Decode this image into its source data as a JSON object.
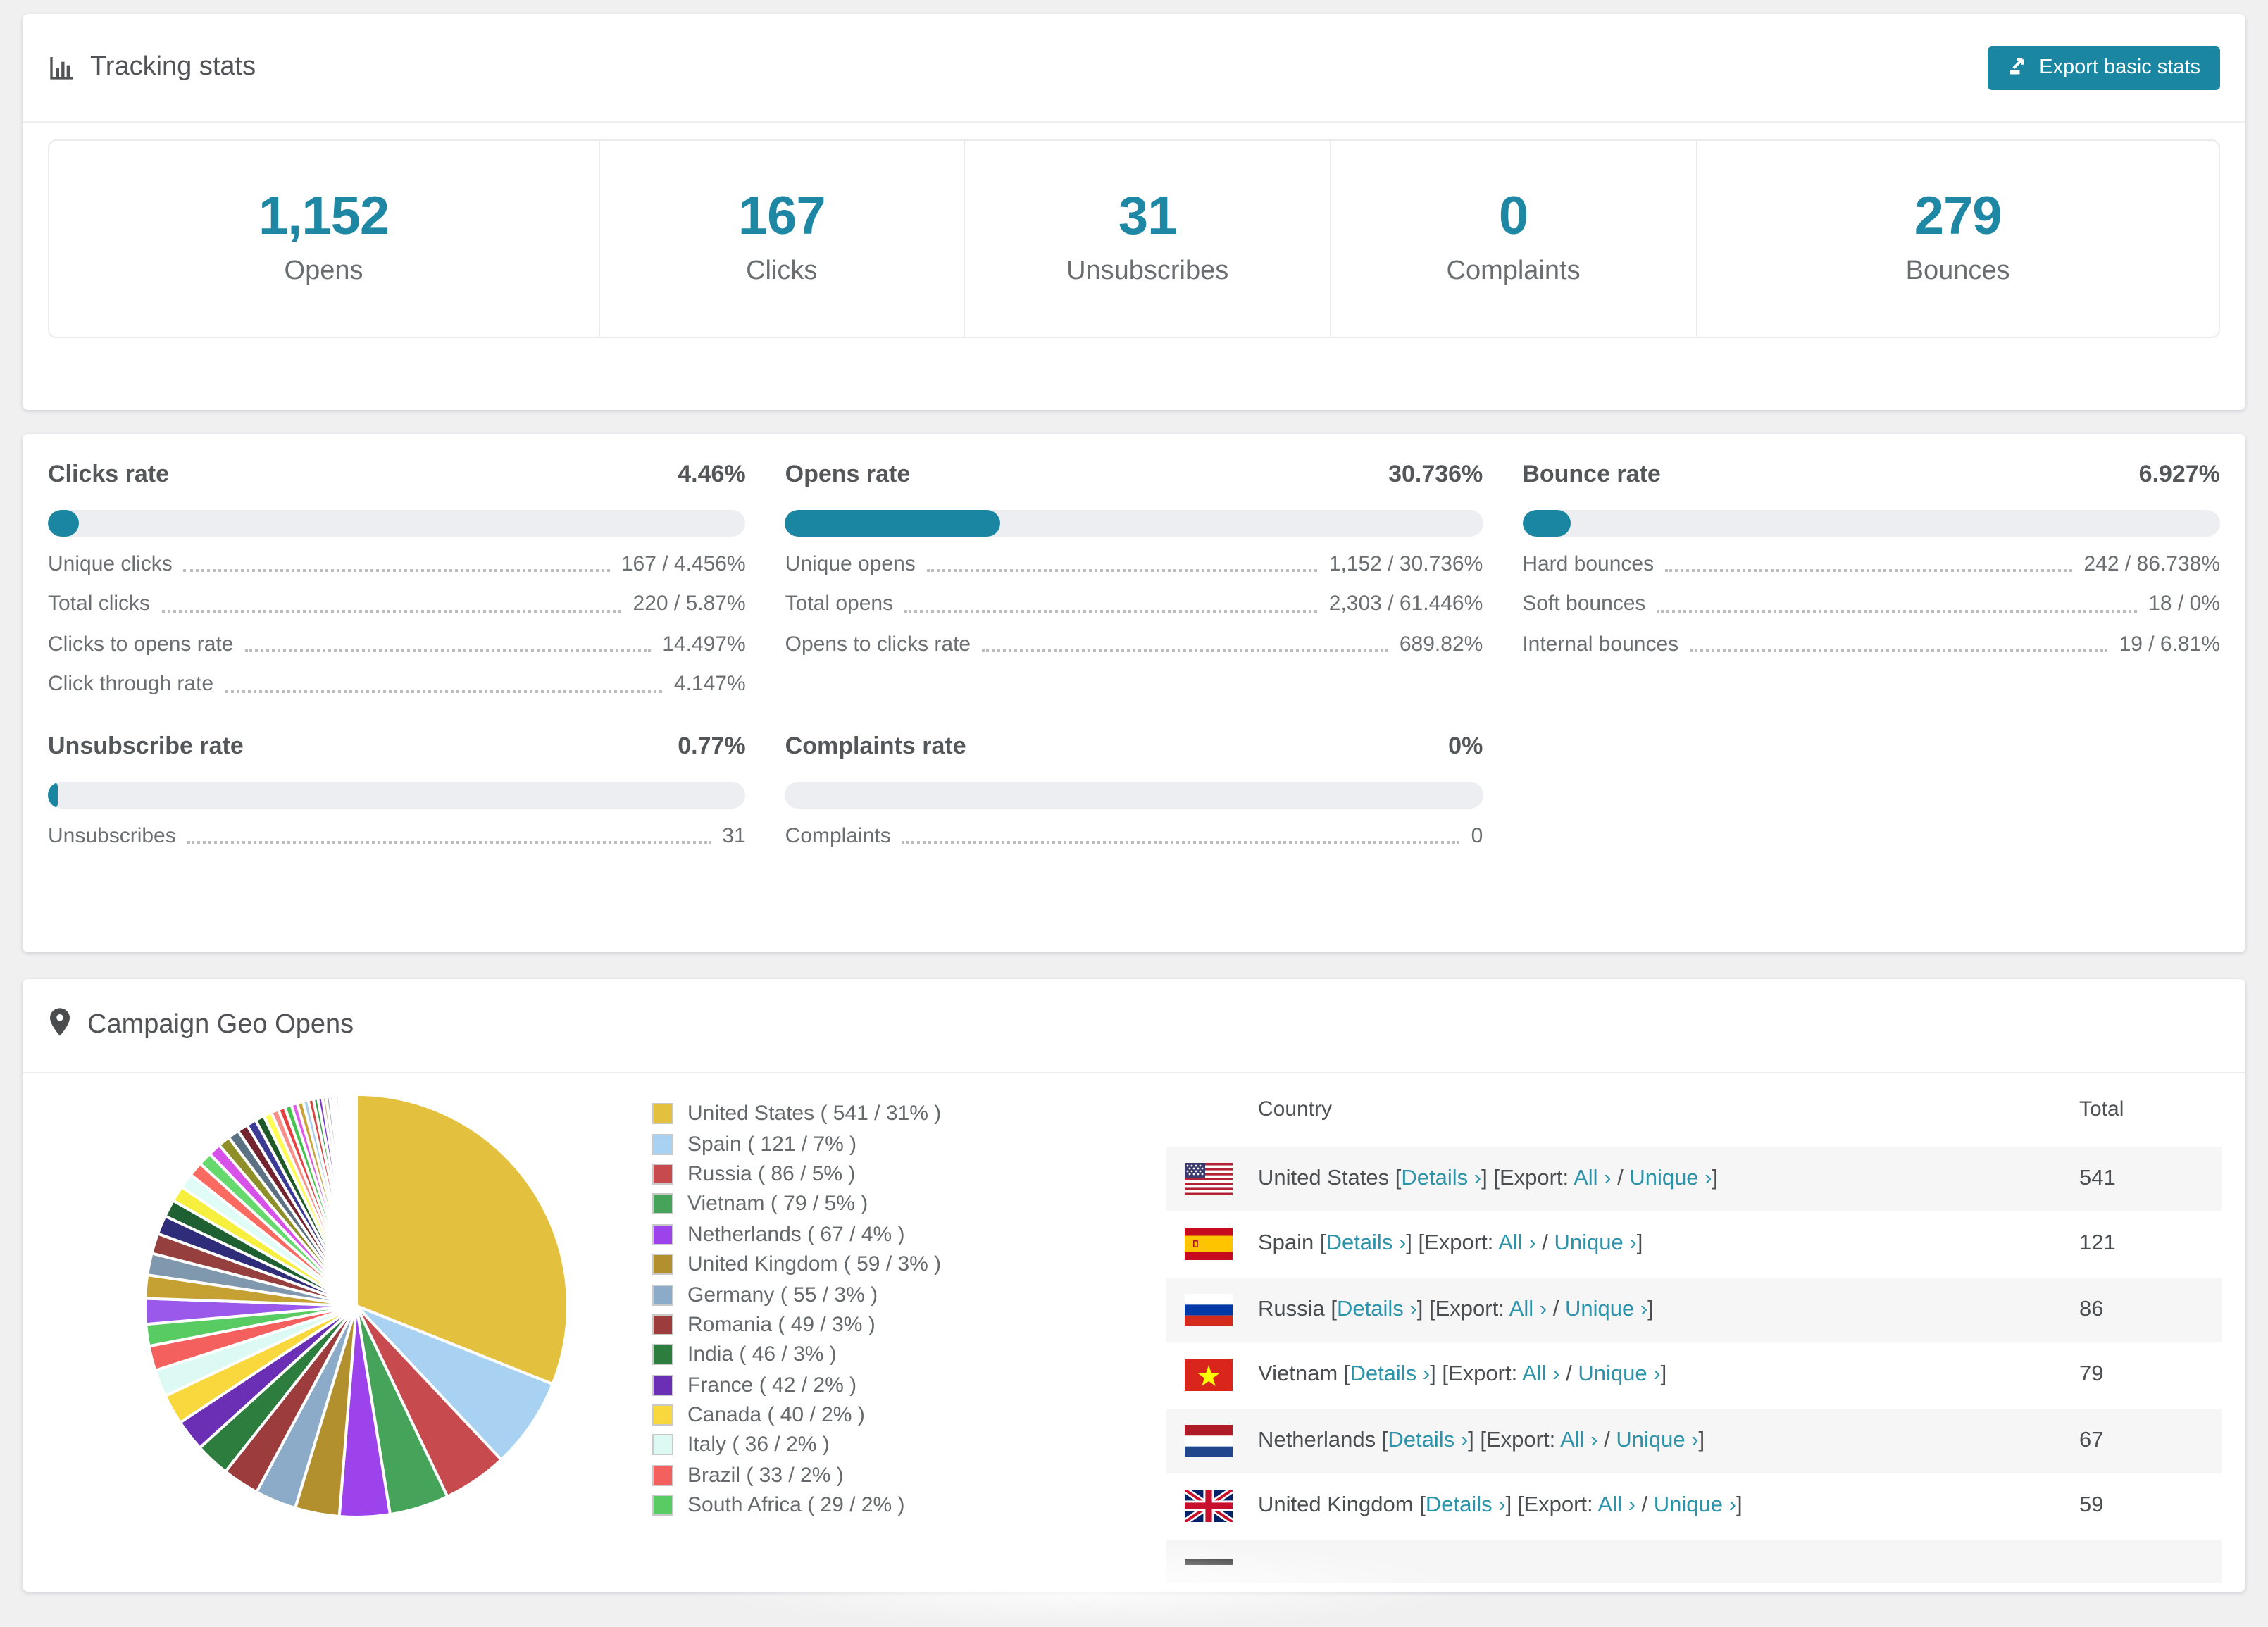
{
  "accent": "#1a86a2",
  "link_color": "#2d93ab",
  "tracking": {
    "title": "Tracking stats",
    "export_button_label": "Export basic stats",
    "summary": [
      {
        "value": "1,152",
        "label": "Opens"
      },
      {
        "value": "167",
        "label": "Clicks"
      },
      {
        "value": "31",
        "label": "Unsubscribes"
      },
      {
        "value": "0",
        "label": "Complaints"
      },
      {
        "value": "279",
        "label": "Bounces"
      }
    ]
  },
  "rates": [
    {
      "title": "Clicks rate",
      "value": "4.46%",
      "percent": 4.46,
      "rows": [
        [
          "Unique clicks",
          "167 / 4.456%"
        ],
        [
          "Total clicks",
          "220 / 5.87%"
        ],
        [
          "Clicks to opens rate",
          "14.497%"
        ],
        [
          "Click through rate",
          "4.147%"
        ]
      ]
    },
    {
      "title": "Opens rate",
      "value": "30.736%",
      "percent": 30.736,
      "rows": [
        [
          "Unique opens",
          "1,152 / 30.736%"
        ],
        [
          "Total opens",
          "2,303 / 61.446%"
        ],
        [
          "Opens to clicks rate",
          "689.82%"
        ]
      ]
    },
    {
      "title": "Bounce rate",
      "value": "6.927%",
      "percent": 6.927,
      "rows": [
        [
          "Hard bounces",
          "242 / 86.738%"
        ],
        [
          "Soft bounces",
          "18 / 0%"
        ],
        [
          "Internal bounces",
          "19 / 6.81%"
        ]
      ]
    },
    {
      "title": "Unsubscribe rate",
      "value": "0.77%",
      "percent": 0.77,
      "rows": [
        [
          "Unsubscribes",
          "31"
        ]
      ]
    },
    {
      "title": "Complaints rate",
      "value": "0%",
      "percent": 0,
      "rows": [
        [
          "Complaints",
          "0"
        ]
      ]
    }
  ],
  "geo": {
    "title": "Campaign Geo Opens",
    "table": {
      "headers": [
        "Country",
        "Total"
      ],
      "details_label": "Details ›",
      "export_prefix": "Export:",
      "all_label": "All ›",
      "unique_label": "Unique ›",
      "rows": [
        {
          "country": "United States",
          "total": "541",
          "flag": "us"
        },
        {
          "country": "Spain",
          "total": "121",
          "flag": "es"
        },
        {
          "country": "Russia",
          "total": "86",
          "flag": "ru"
        },
        {
          "country": "Vietnam",
          "total": "79",
          "flag": "vn"
        },
        {
          "country": "Netherlands",
          "total": "67",
          "flag": "nl"
        },
        {
          "country": "United Kingdom",
          "total": "59",
          "flag": "gb"
        }
      ],
      "partial_row": {
        "flag_stripe_color": "#151515"
      }
    }
  },
  "chart_data": {
    "type": "pie",
    "title": "Campaign Geo Opens",
    "legend_position": "right",
    "labels": [
      "United States",
      "Spain",
      "Russia",
      "Vietnam",
      "Netherlands",
      "United Kingdom",
      "Germany",
      "Romania",
      "India",
      "France",
      "Canada",
      "Italy",
      "Brazil",
      "South Africa"
    ],
    "values": [
      541,
      121,
      86,
      79,
      67,
      59,
      55,
      49,
      46,
      42,
      40,
      36,
      33,
      29
    ],
    "percents": [
      31,
      7,
      5,
      5,
      4,
      3,
      3,
      3,
      3,
      2,
      2,
      2,
      2,
      2
    ],
    "colors": [
      "#e4c03f",
      "#a9d2f2",
      "#c64a4e",
      "#46a45a",
      "#9d43eb",
      "#b2902e",
      "#8cabc8",
      "#9d3c3c",
      "#2d7e3e",
      "#6a2fb4",
      "#f9d83d",
      "#dcfaf3",
      "#f4605d",
      "#58cb63"
    ],
    "others_values": [
      34,
      31,
      29,
      27,
      25,
      23,
      21,
      20,
      19,
      18,
      17,
      16,
      15,
      14,
      13,
      12,
      11,
      10,
      9,
      9,
      8,
      8,
      7,
      7,
      6,
      6,
      5,
      5,
      4,
      4,
      4,
      3,
      3,
      3,
      2,
      2,
      2,
      2,
      1,
      1,
      1,
      1,
      1,
      1
    ],
    "others_colors": [
      "#9b59ec",
      "#c5a032",
      "#8098ad",
      "#953f3f",
      "#2f2d7a",
      "#1f6032",
      "#f6ef3e",
      "#dffcf7",
      "#fa6a60",
      "#66d96e",
      "#d752e8",
      "#8f8f2a",
      "#5c7284",
      "#74242e",
      "#3b3a95",
      "#1d5a28",
      "#fdfd55",
      "#f98f88",
      "#e84040",
      "#46c24e",
      "#e05ce8",
      "#c9a33a",
      "#a7cdec",
      "#d7433f",
      "#3a9e46",
      "#7a3bd0",
      "#c9b089",
      "#9aa7b5"
    ]
  }
}
